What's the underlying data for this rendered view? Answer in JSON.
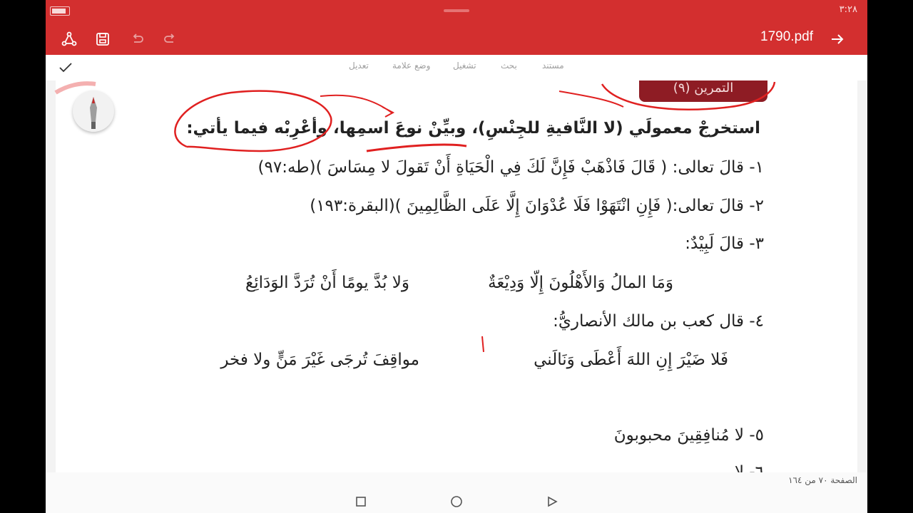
{
  "status": {
    "time": "٣:٢٨"
  },
  "toolbar": {
    "title": "1790.pdf",
    "accent": "#d32f2f"
  },
  "menu": {
    "items": [
      "مستند",
      "بحث",
      "تشغيل",
      "وضع علامة",
      "تعديل"
    ]
  },
  "document": {
    "banner": "التمرين (٩)",
    "heading": "استخرجْ معمولَي (لا النَّافيةِ للجِنْسِ)، وبيِّنْ نوعَ اسمِها، وأعْرِبْه فيما يأتي:",
    "lines": [
      "١- قالَ تعالى: ( قَالَ فَاذْهَبْ فَإِنَّ لَكَ فِي الْحَيَاةِ أَنْ تَقولَ لا مِسَاسَ )(طه:٩٧)",
      "٢- قالَ تعالى:( فَإِنِ انْتَهَوْا فَلَا عُدْوَانَ إِلَّا عَلَى الظَّالِمِينَ )(البقرة:١٩٣)",
      "٣- قالَ لَبِيْدٌ:"
    ],
    "poem1": {
      "first": "وَمَا المالُ وَالأَهْلُونَ إِلّا وَدِيْعَةٌ",
      "second": "وَلا بُدَّ يومًا أَنْ تُرَدَّ الوَدَائِعُ"
    },
    "line4": "٤- قال كعب بن مالك الأنصاريُّ:",
    "poem2": {
      "first": "فَلا ضَيْرَ إِنِ اللهَ أَعْطَى وَنَالَني",
      "second": "مواقِفَ تُرجَى غَيْرَ مَنٍّ ولا فخر"
    },
    "line5": "٥- لا مُنافِقِينَ محبوبونَ",
    "line6_partial": "٦- لا ..."
  },
  "footer": {
    "page_info": "الصفحة ٧٠ من ١٦٤"
  },
  "icons": [
    "battery-icon",
    "share-icon",
    "save-icon",
    "undo-icon",
    "redo-icon",
    "forward-arrow-icon",
    "check-icon",
    "pen-icon",
    "nav-square-icon",
    "nav-circle-icon",
    "nav-triangle-icon"
  ]
}
